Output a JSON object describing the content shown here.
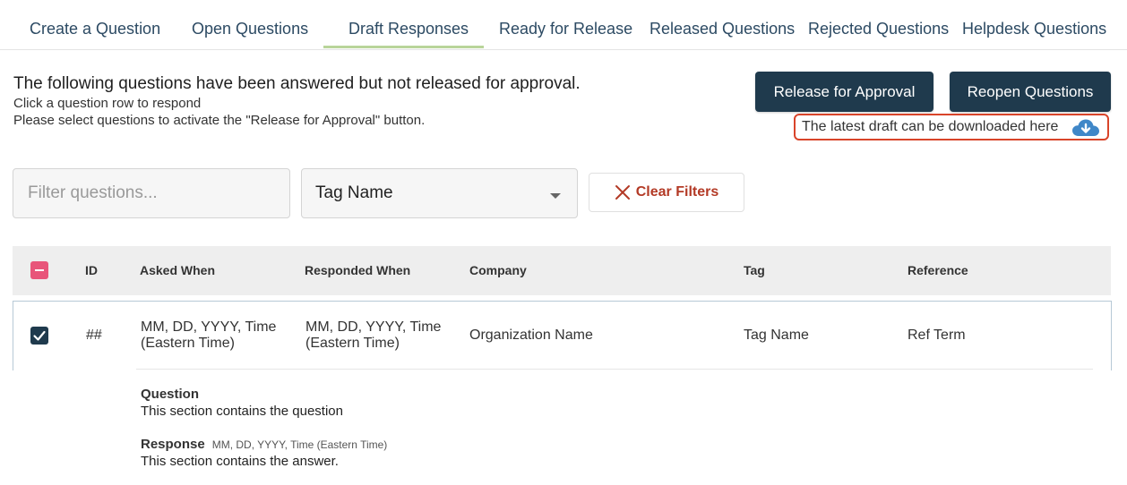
{
  "tabs": [
    {
      "label": "Create a Question"
    },
    {
      "label": "Open Questions"
    },
    {
      "label": "Draft Responses",
      "active": true
    },
    {
      "label": "Ready for Release"
    },
    {
      "label": "Released Questions"
    },
    {
      "label": "Rejected Questions"
    },
    {
      "label": "Helpdesk Questions"
    }
  ],
  "intro": {
    "title": "The following questions have been answered but not released for approval.",
    "line1": "Click a question row to respond",
    "line2": "Please select questions to activate the \"Release for Approval\" button."
  },
  "actions": {
    "release_label": "Release for Approval",
    "reopen_label": "Reopen Questions",
    "download_text": "The latest draft can be downloaded here",
    "download_icon": "cloud-download-icon"
  },
  "filters": {
    "search_placeholder": "Filter questions...",
    "tag_selected": "Tag Name",
    "clear_label": "Clear Filters"
  },
  "table": {
    "headers": [
      "ID",
      "Asked When",
      "Responded When",
      "Company",
      "Tag",
      "Reference"
    ],
    "rows": [
      {
        "id": "##",
        "asked_line1": "MM, DD, YYYY, Time",
        "asked_line2": "(Eastern Time)",
        "responded_line1": "MM, DD, YYYY, Time",
        "responded_line2": "(Eastern Time)",
        "company": "Organization Name",
        "tag": "Tag Name",
        "reference": "Ref Term",
        "selected": true
      }
    ]
  },
  "detail": {
    "question_label": "Question",
    "question_text": "This section contains the question",
    "response_label": "Response",
    "response_date": "MM, DD, YYYY, Time (Eastern Time)",
    "response_text": "This section contains the answer."
  },
  "colors": {
    "primary_dark": "#1f3a4d",
    "accent_red": "#d9442a",
    "indeterminate_pink": "#e8557a",
    "tab_underline": "#b9d59a",
    "cloud_blue": "#3f87c8"
  }
}
